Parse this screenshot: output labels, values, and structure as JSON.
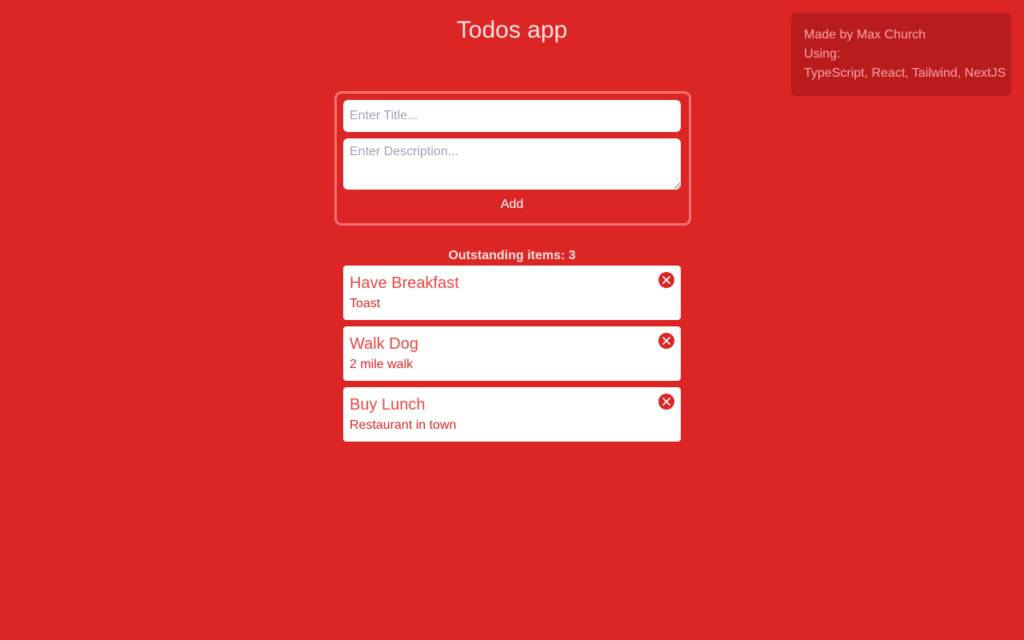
{
  "header": {
    "title": "Todos app"
  },
  "credits": {
    "line1": "Made by Max Church",
    "line2": "Using:",
    "line3": "TypeScript, React, Tailwind, NextJS"
  },
  "form": {
    "title_placeholder": "Enter Title...",
    "title_value": "",
    "description_placeholder": "Enter Description...",
    "description_value": "",
    "add_label": "Add"
  },
  "outstanding": {
    "label": "Outstanding items: 3"
  },
  "todos": [
    {
      "title": "Have Breakfast",
      "description": "Toast",
      "delete_icon": "x-circle-icon"
    },
    {
      "title": "Walk Dog",
      "description": "2 mile walk",
      "delete_icon": "x-circle-icon"
    },
    {
      "title": "Buy Lunch",
      "description": "Restaurant in town",
      "delete_icon": "x-circle-icon"
    }
  ],
  "colors": {
    "background": "#dc2626",
    "accent_text": "#ef4444",
    "credits_background": "#b91c1c",
    "form_border": "#f87171"
  }
}
